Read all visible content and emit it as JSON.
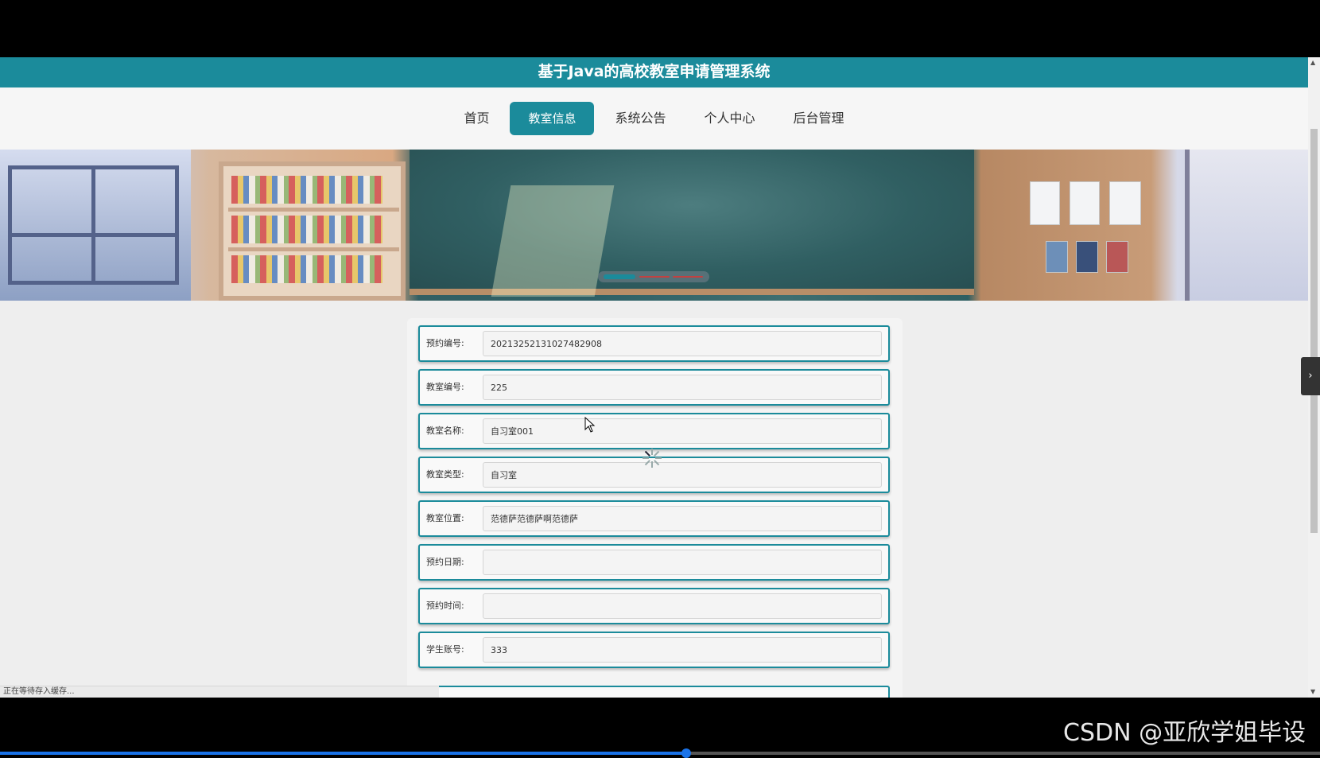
{
  "app": {
    "title": "基于Java的高校教室申请管理系统"
  },
  "nav": {
    "items": [
      {
        "label": "首页",
        "active": false
      },
      {
        "label": "教室信息",
        "active": true
      },
      {
        "label": "系统公告",
        "active": false
      },
      {
        "label": "个人中心",
        "active": false
      },
      {
        "label": "后台管理",
        "active": false
      }
    ]
  },
  "carousel": {
    "slides": 3,
    "active_slide": 1
  },
  "form": {
    "fields": [
      {
        "label": "预约编号:",
        "value": "20213252131027482908"
      },
      {
        "label": "教室编号:",
        "value": "225"
      },
      {
        "label": "教室名称:",
        "value": "自习室001"
      },
      {
        "label": "教室类型:",
        "value": "自习室"
      },
      {
        "label": "教室位置:",
        "value": "范德萨范德萨啊范德萨"
      },
      {
        "label": "预约日期:",
        "value": ""
      },
      {
        "label": "预约时间:",
        "value": ""
      },
      {
        "label": "学生账号:",
        "value": "333"
      }
    ]
  },
  "status_bar": {
    "text": "正在等待存入缓存..."
  },
  "side_toggle": {
    "icon": "chevron-right-icon"
  },
  "watermark": {
    "text": "CSDN @亚欣学姐毕设"
  },
  "video": {
    "progress": 0.52
  },
  "colors": {
    "accent": "#1b8b9b"
  }
}
